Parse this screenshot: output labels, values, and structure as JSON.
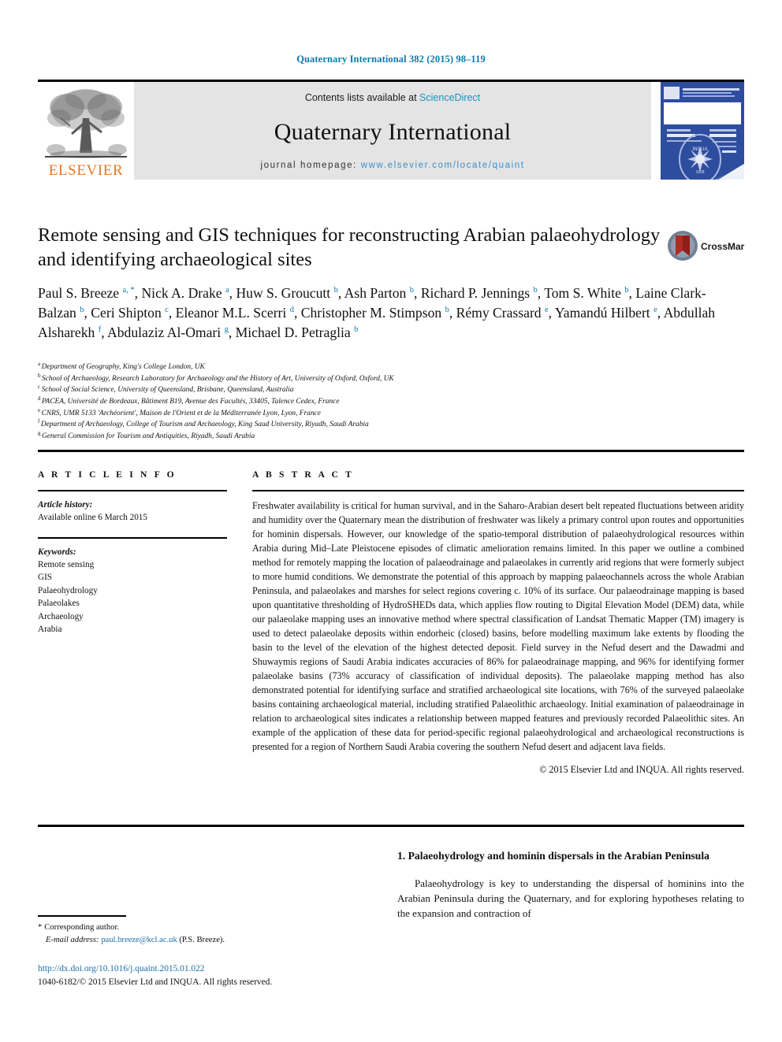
{
  "running_head": "Quaternary International 382 (2015) 98–119",
  "header": {
    "contents_prefix": "Contents lists available at ",
    "sciencedirect": "ScienceDirect",
    "journal_name": "Quaternary International",
    "homepage_label": "journal homepage:",
    "homepage_url": "www.elsevier.com/locate/quaint",
    "publisher_word": "ELSEVIER",
    "cover_title": "QUATERNARY INTERNATIONAL",
    "accent_link_color": "#1593c4",
    "accent_orange": "#e87722",
    "band_background": "#e4e4e4",
    "cover_blue": "#2e4d9e"
  },
  "article": {
    "title": "Remote sensing and GIS techniques for reconstructing Arabian palaeohydrology and identifying archaeological sites",
    "crossmark_label": "CrossMark",
    "authors_html": "Paul S. Breeze <sup>a, *</sup>, Nick A. Drake <sup>a</sup>, Huw S. Groucutt <sup>b</sup>, Ash Parton <sup>b</sup>, Richard P. Jennings <sup>b</sup>, Tom S. White <sup>b</sup>, Laine Clark-Balzan <sup>b</sup>, Ceri Shipton <sup>c</sup>, Eleanor M.L. Scerri <sup>d</sup>, Christopher M. Stimpson <sup>b</sup>, Rémy Crassard <sup>e</sup>, Yamandú Hilbert <sup>e</sup>, Abdullah Alsharekh <sup>f</sup>, Abdulaziz Al-Omari <sup>g</sup>, Michael D. Petraglia <sup>b</sup>",
    "affiliations": [
      {
        "mark": "a",
        "text": "Department of Geography, King's College London, UK"
      },
      {
        "mark": "b",
        "text": "School of Archaeology, Research Laboratory for Archaeology and the History of Art, University of Oxford, Oxford, UK"
      },
      {
        "mark": "c",
        "text": "School of Social Science, University of Queensland, Brisbane, Queensland, Australia"
      },
      {
        "mark": "d",
        "text": "PACEA, Université de Bordeaux, Bâtiment B19, Avenue des Facultés, 33405, Talence Cedex, France"
      },
      {
        "mark": "e",
        "text": "CNRS, UMR 5133 'Archéorient', Maison de l'Orient et de la Méditerranée Lyon, Lyon, France"
      },
      {
        "mark": "f",
        "text": "Department of Archaeology, College of Tourism and Archaeology, King Saud University, Riyadh, Saudi Arabia"
      },
      {
        "mark": "g",
        "text": "General Commission for Tourism and Antiquities, Riyadh, Saudi Arabia"
      }
    ]
  },
  "article_info": {
    "label": "A R T I C L E    I N F O",
    "history_label": "Article history:",
    "history_value": "Available online 6 March 2015",
    "keywords_label": "Keywords:",
    "keywords": [
      "Remote sensing",
      "GIS",
      "Palaeohydrology",
      "Palaeolakes",
      "Archaeology",
      "Arabia"
    ]
  },
  "abstract": {
    "label": "A B S T R A C T",
    "text": "Freshwater availability is critical for human survival, and in the Saharo-Arabian desert belt repeated fluctuations between aridity and humidity over the Quaternary mean the distribution of freshwater was likely a primary control upon routes and opportunities for hominin dispersals. However, our knowledge of the spatio-temporal distribution of palaeohydrological resources within Arabia during Mid–Late Pleistocene episodes of climatic amelioration remains limited. In this paper we outline a combined method for remotely mapping the location of palaeodrainage and palaeolakes in currently arid regions that were formerly subject to more humid conditions. We demonstrate the potential of this approach by mapping palaeochannels across the whole Arabian Peninsula, and palaeolakes and marshes for select regions covering c. 10% of its surface. Our palaeodrainage mapping is based upon quantitative thresholding of HydroSHEDs data, which applies flow routing to Digital Elevation Model (DEM) data, while our palaeolake mapping uses an innovative method where spectral classification of Landsat Thematic Mapper (TM) imagery is used to detect palaeolake deposits within endorheic (closed) basins, before modelling maximum lake extents by flooding the basin to the level of the elevation of the highest detected deposit. Field survey in the Nefud desert and the Dawadmi and Shuwaymis regions of Saudi Arabia indicates accuracies of 86% for palaeodrainage mapping, and 96% for identifying former palaeolake basins (73% accuracy of classification of individual deposits). The palaeolake mapping method has also demonstrated potential for identifying surface and stratified archaeological site locations, with 76% of the surveyed palaeolake basins containing archaeological material, including stratified Palaeolithic archaeology. Initial examination of palaeodrainage in relation to archaeological sites indicates a relationship between mapped features and previously recorded Palaeolithic sites. An example of the application of these data for period-specific regional palaeohydrological and archaeological reconstructions is presented for a region of Northern Saudi Arabia covering the southern Nefud desert and adjacent lava fields.",
    "copyright": "© 2015 Elsevier Ltd and INQUA. All rights reserved."
  },
  "body": {
    "section_number_title": "1. Palaeohydrology and hominin dispersals in the Arabian Peninsula",
    "first_paragraph": "Palaeohydrology is key to understanding the dispersal of hominins into the Arabian Peninsula during the Quaternary, and for exploring hypotheses relating to the expansion and contraction of"
  },
  "footer": {
    "corresponding_star": "*",
    "corresponding_label": "Corresponding author.",
    "email_label": "E-mail address:",
    "email": "paul.breeze@kcl.ac.uk",
    "email_owner": "(P.S. Breeze).",
    "doi_url": "http://dx.doi.org/10.1016/j.quaint.2015.01.022",
    "issn_line": "1040-6182/© 2015 Elsevier Ltd and INQUA. All rights reserved."
  }
}
